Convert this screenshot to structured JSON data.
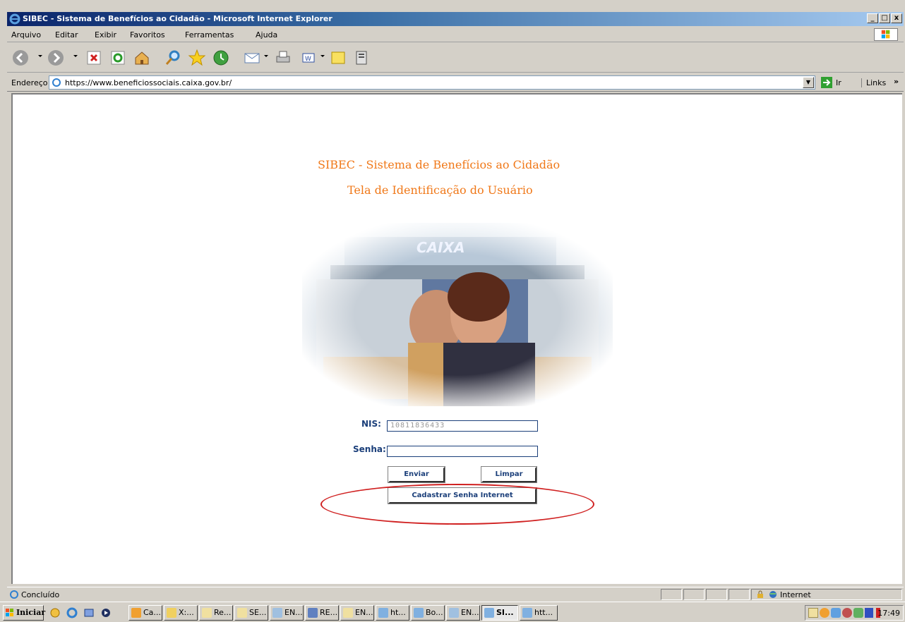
{
  "window": {
    "title": "SIBEC - Sistema de Benefícios ao Cidadão - Microsoft Internet Explorer",
    "min": "_",
    "max": "□",
    "close": "x"
  },
  "menu": [
    "Arquivo",
    "Editar",
    "Exibir",
    "Favoritos",
    "Ferramentas",
    "Ajuda"
  ],
  "address": {
    "label": "Endereço",
    "url": "https://www.beneficiossociais.caixa.gov.br/",
    "go": "Ir",
    "links": "Links"
  },
  "page": {
    "title": "SIBEC - Sistema de Benefícios ao Cidadão",
    "subtitle": "Tela de Identificação do Usuário",
    "banner_text": "CAIXA",
    "nis_label": "NIS:",
    "nis_value": "10811836433",
    "senha_label": "Senha:",
    "senha_value": "",
    "enviar": "Enviar",
    "limpar": "Limpar",
    "cadastrar": "Cadastrar Senha Internet"
  },
  "status": {
    "text": "Concluído",
    "zone": "Internet"
  },
  "taskbar": {
    "start": "Iniciar",
    "buttons": [
      "Ca...",
      "X:...",
      "Re...",
      "SE...",
      "EN...",
      "RE...",
      "EN...",
      "ht...",
      "Bo...",
      "EN...",
      "SI...",
      "htt..."
    ],
    "clock": "17:49"
  },
  "colors": {
    "accent_orange": "#f07818",
    "form_blue": "#1b3f7a",
    "highlight_red": "#d02020",
    "title_blue": "#0a246a"
  }
}
